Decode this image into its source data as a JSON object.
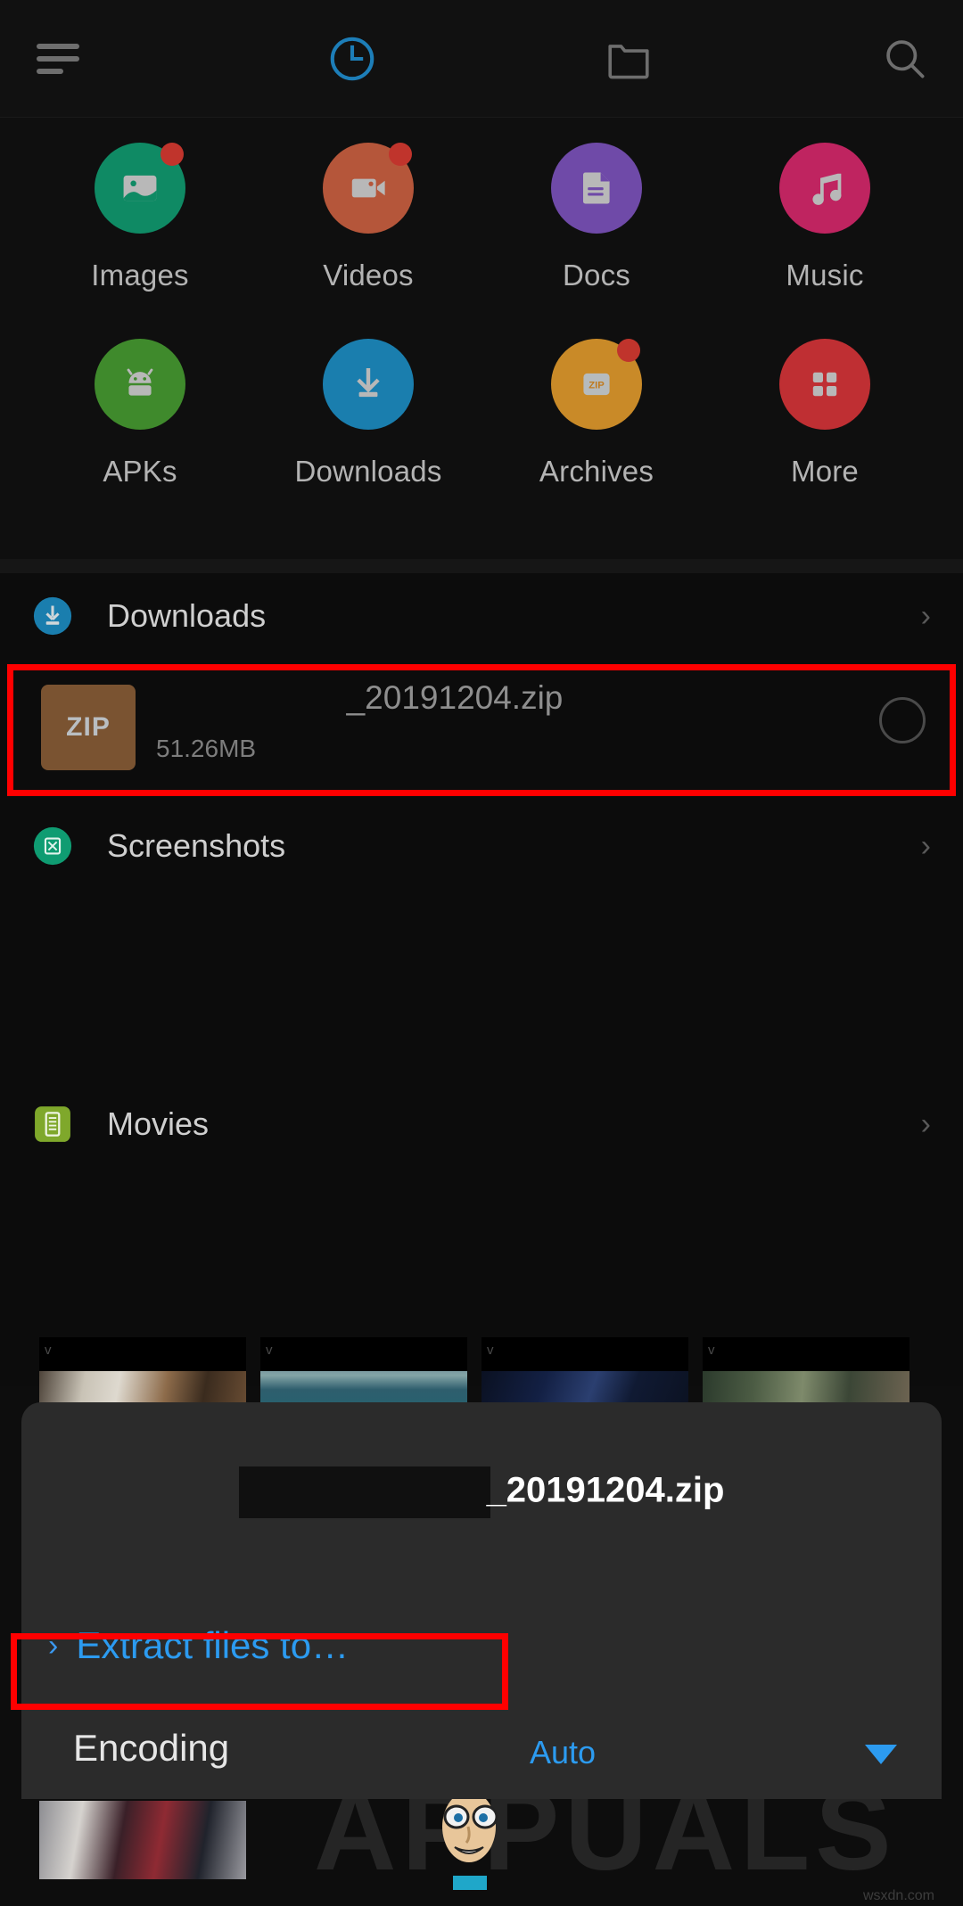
{
  "topbar": {
    "menu_icon": "hamburger-menu-icon",
    "tabs": [
      {
        "name": "recent",
        "icon": "clock-icon",
        "active": true
      },
      {
        "name": "folders",
        "icon": "folder-icon",
        "active": false
      }
    ],
    "search_icon": "search-icon"
  },
  "categories": [
    {
      "label": "Images",
      "icon": "image-icon",
      "color": "#0f8a64",
      "badge": true
    },
    {
      "label": "Videos",
      "icon": "video-icon",
      "color": "#b5563a",
      "badge": true
    },
    {
      "label": "Docs",
      "icon": "document-icon",
      "color": "#6f4aa8",
      "badge": false
    },
    {
      "label": "Music",
      "icon": "music-icon",
      "color": "#bf2460",
      "badge": false
    },
    {
      "label": "APKs",
      "icon": "android-icon",
      "color": "#3f8a2c",
      "badge": false
    },
    {
      "label": "Downloads",
      "icon": "download-icon",
      "color": "#1a7eae",
      "badge": false
    },
    {
      "label": "Archives",
      "icon": "zip-icon",
      "color": "#c98a28",
      "badge": true
    },
    {
      "label": "More",
      "icon": "grid-icon",
      "color": "#bf2f33",
      "badge": false
    }
  ],
  "sections": [
    {
      "title": "Downloads",
      "icon": "download-icon",
      "icon_color": "#1a7eae",
      "chevron": "›"
    },
    {
      "title": "Screenshots",
      "icon": "screenshot-icon",
      "icon_color": "#0f9c72",
      "chevron": "›"
    },
    {
      "title": "Movies",
      "icon": "movies-icon",
      "icon_color": "#7fa82b",
      "chevron": "›"
    }
  ],
  "file_row": {
    "thumb_label": "ZIP",
    "name": "_20191204.zip",
    "size": "51.26MB",
    "checkbox": "unchecked",
    "highlight_color": "#ff0000"
  },
  "thumbnails": [
    {
      "badge": "v"
    },
    {
      "badge": "v"
    },
    {
      "badge": "v"
    },
    {
      "badge": "v"
    }
  ],
  "sheet": {
    "title": "_20191204.zip",
    "extract_label": "Extract files to…",
    "extract_chevron": "›",
    "encoding_label": "Encoding",
    "encoding_value": "Auto",
    "caret": "dropdown-caret-icon",
    "accent_color": "#2c9bf0",
    "highlight_color": "#ff0000"
  },
  "watermark": {
    "text": "APPUALS",
    "site": "wsxdn.com"
  }
}
